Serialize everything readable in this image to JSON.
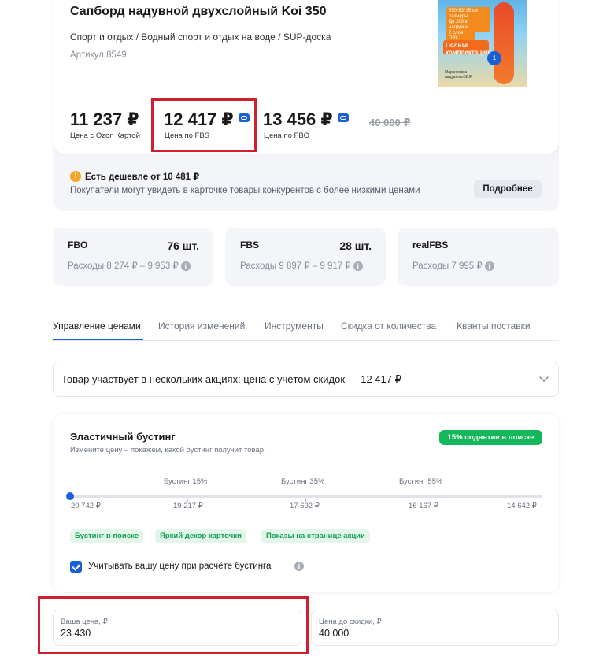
{
  "product": {
    "title": "Сапборд надувной двухслойный Koi 350",
    "category": "Спорт и отдых / Водный спорт и отдых на воде / SUP-доска",
    "article": "Артикул 8549",
    "image": {
      "tag1": "350*83*15 см размеры",
      "tag2": "До 200 кг нагрузка",
      "tag3": "2 слоя ПВХ",
      "orange": "Полная комплектация",
      "badge": "1",
      "caption": "Маркировка надувного SUP"
    }
  },
  "prices": {
    "ozon_card": {
      "value": "11 237 ₽",
      "label": "Цена с Ozon Картой"
    },
    "fbs": {
      "value": "12 417 ₽",
      "label": "Цена по FBS"
    },
    "fbo": {
      "value": "13 456 ₽",
      "label": "Цена по FBO"
    },
    "old": "40 000 ₽"
  },
  "cheaper": {
    "icon": "!",
    "title": "Есть дешевле от 10 481 ₽",
    "text": "Покупатели могут увидеть в карточке товары конкурентов с более низкими ценами",
    "button": "Подробнее"
  },
  "stock": [
    {
      "name": "FBO",
      "qty": "76 шт.",
      "cost": "Расходы 8 274 ₽ – 9 953 ₽"
    },
    {
      "name": "FBS",
      "qty": "28 шт.",
      "cost": "Расходы 9 897 ₽ – 9 917 ₽"
    },
    {
      "name": "realFBS",
      "qty": "",
      "cost": "Расходы 7 995 ₽"
    }
  ],
  "info_glyph": "i",
  "tabs": [
    "Управление ценами",
    "История изменений",
    "Инструменты",
    "Скидка от количества",
    "Кванты поставки"
  ],
  "promo": {
    "text": "Товар участвует в нескольких акциях: цена с учётом скидок — 12 417 ₽"
  },
  "boosting": {
    "title": "Эластичный бустинг",
    "subtitle": "Измените цену – покажем, какой бустинг получит товар",
    "badge": "15% поднятие в поиске",
    "steps": [
      "Бустинг 15%",
      "Бустинг 35%",
      "Бустинг 55%"
    ],
    "scale": [
      "20 742 ₽",
      "19 217 ₽",
      "17 692 ₽",
      "16 167 ₽",
      "14 642 ₽"
    ],
    "chips": [
      "Бустинг в поиске",
      "Яркий декор карточки",
      "Показы на странице акции"
    ],
    "checkbox_label": "Учитывать вашу цену при расчёте бустинга",
    "checkbox_checked": true
  },
  "fields": {
    "your_price": {
      "label": "Ваша цена, ₽",
      "value": "23 430"
    },
    "before_discount": {
      "label": "Цена до скидки, ₽",
      "value": "40 000"
    }
  },
  "colors": {
    "accent": "#1b5fd6",
    "highlight": "#d0202e",
    "success": "#14b85a",
    "warning": "#f5a623"
  }
}
